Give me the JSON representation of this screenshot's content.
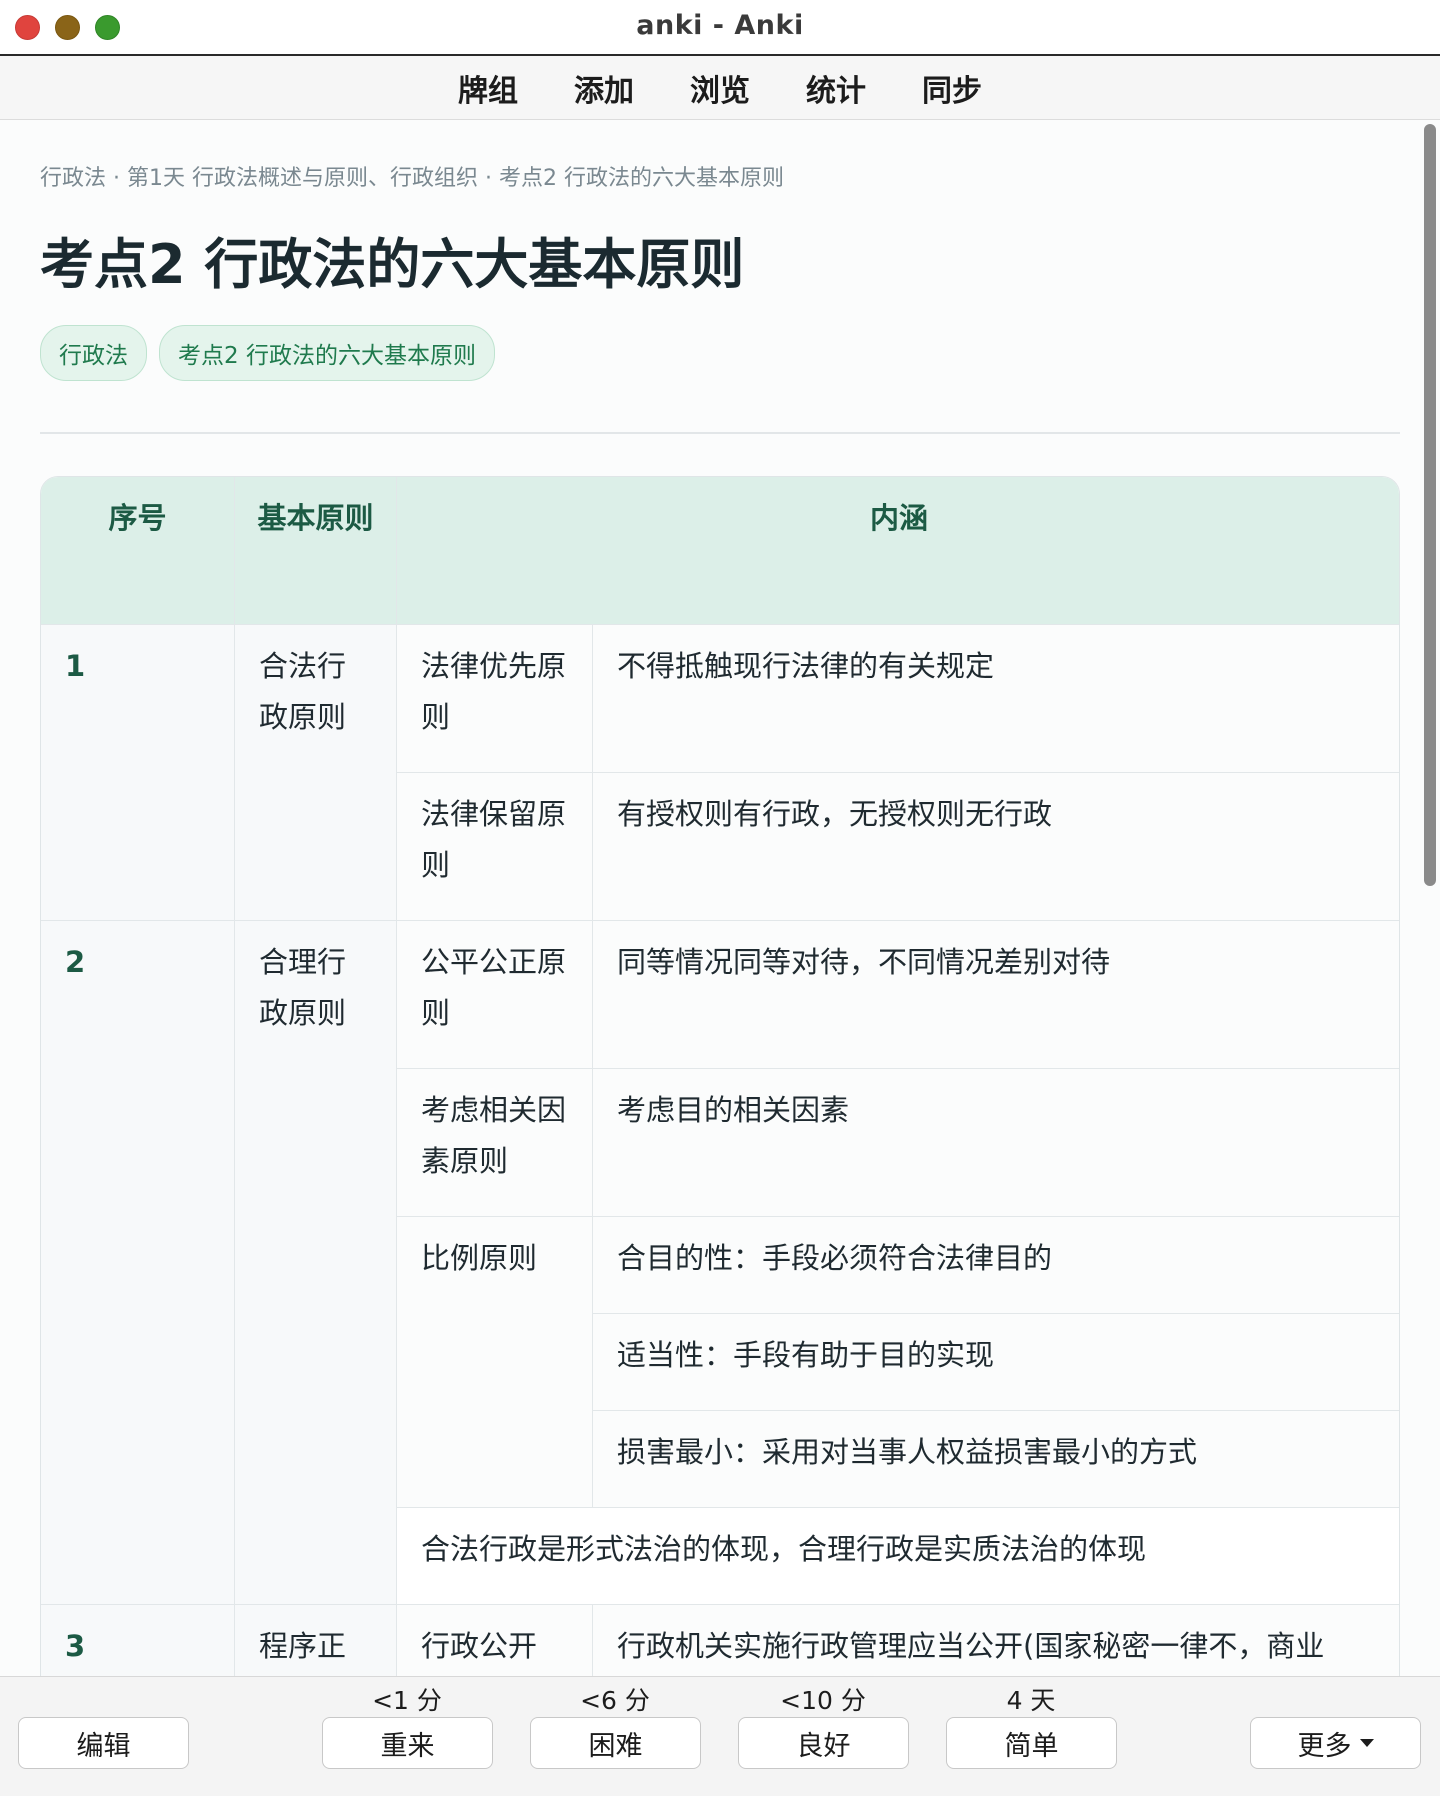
{
  "window": {
    "title": "anki - Anki"
  },
  "toolbar": {
    "items": [
      "牌组",
      "添加",
      "浏览",
      "统计",
      "同步"
    ]
  },
  "card": {
    "breadcrumb": "行政法 · 第1天 行政法概述与原则、行政组织 · 考点2 行政法的六大基本原则",
    "title": "考点2 行政法的六大基本原则",
    "tags": [
      "行政法",
      "考点2 行政法的六大基本原则"
    ],
    "table": {
      "headers": [
        "序号",
        "基本原则",
        "内涵"
      ],
      "rows": [
        {
          "num": "1",
          "principle": "合法行政原则",
          "items": [
            {
              "sub": "法律优先原则",
              "desc": "不得抵触现行法律的有关规定"
            },
            {
              "sub": "法律保留原则",
              "desc": "有授权则有行政，无授权则无行政"
            }
          ]
        },
        {
          "num": "2",
          "principle": "合理行政原则",
          "items": [
            {
              "sub": "公平公正原则",
              "desc": "同等情况同等对待，不同情况差别对待"
            },
            {
              "sub": "考虑相关因素原则",
              "desc": "考虑目的相关因素"
            },
            {
              "sub": "比例原则",
              "descs": [
                "合目的性：手段必须符合法律目的",
                "适当性：手段有助于目的实现",
                "损害最小：采用对当事人权益损害最小的方式"
              ]
            }
          ],
          "note": "合法行政是形式法治的体现，合理行政是实质法治的体现"
        },
        {
          "num": "3",
          "principle": "程序正",
          "items": [
            {
              "sub": "行政公开",
              "desc": "行政机关实施行政管理应当公开(国家秘密一律不，商业"
            }
          ]
        }
      ]
    }
  },
  "answer_bar": {
    "edit_label": "编辑",
    "more_label": "更多",
    "buttons": [
      {
        "due": "<1 分",
        "label": "重来"
      },
      {
        "due": "<6 分",
        "label": "困难"
      },
      {
        "due": "<10 分",
        "label": "良好"
      },
      {
        "due": "4 天",
        "label": "简单"
      }
    ]
  }
}
